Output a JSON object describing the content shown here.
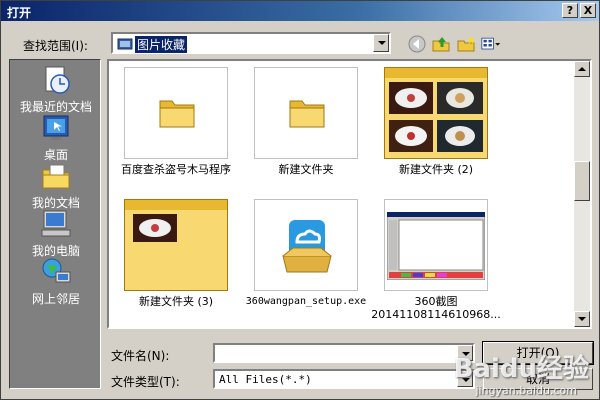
{
  "window": {
    "title": "打开",
    "help": "?",
    "close": "X"
  },
  "lookin": {
    "label": "查找范围(I):",
    "value": "图片收藏"
  },
  "places": [
    {
      "label": "我最近的文档",
      "icon": "recent-documents-icon"
    },
    {
      "label": "桌面",
      "icon": "desktop-icon"
    },
    {
      "label": "我的文档",
      "icon": "my-documents-icon"
    },
    {
      "label": "我的电脑",
      "icon": "my-computer-icon"
    },
    {
      "label": "网上邻居",
      "icon": "network-places-icon"
    }
  ],
  "files": [
    {
      "name": "百度查杀盗号木马程序",
      "kind": "folder"
    },
    {
      "name": "新建文件夹",
      "kind": "folder"
    },
    {
      "name": "新建文件夹 (2)",
      "kind": "photo-folder"
    },
    {
      "name": "新建文件夹 (3)",
      "kind": "photo-folder-single"
    },
    {
      "name": "360wangpan_setup.exe",
      "kind": "exe"
    },
    {
      "name": "360截图",
      "name2": "20141108114610968...",
      "kind": "screenshot"
    }
  ],
  "filename": {
    "label": "文件名(N):",
    "value": ""
  },
  "filetype": {
    "label": "文件类型(T):",
    "value": "All Files(*.*)"
  },
  "buttons": {
    "open": "打开(O)",
    "cancel": "取消"
  },
  "watermark": {
    "brand": "Baidu经验",
    "url": "jingyan.baidu.com"
  },
  "colors": {
    "titlebar": "#0a246a",
    "face": "#d4d0c8",
    "places_bg": "#808080"
  }
}
